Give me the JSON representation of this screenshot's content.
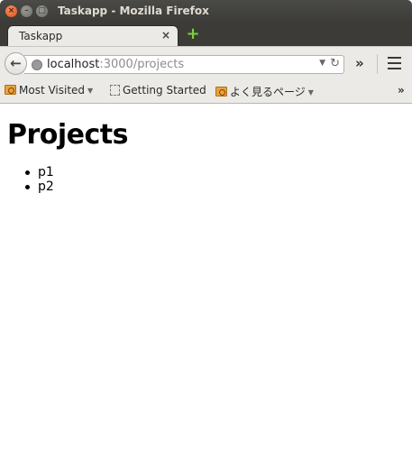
{
  "window": {
    "title": "Taskapp - Mozilla Firefox",
    "close_glyph": "×",
    "minimize_glyph": "–",
    "maximize_glyph": "□"
  },
  "tabs": [
    {
      "label": "Taskapp",
      "close_glyph": "×",
      "active": true
    }
  ],
  "new_tab_glyph": "+",
  "nav": {
    "back_glyph": "←",
    "url_host": "localhost",
    "url_path": ":3000/projects",
    "url_dropdown_glyph": "▼",
    "reload_glyph": "↻",
    "overflow_glyph": "»",
    "menu_icon": "hamburger-icon"
  },
  "bookmarks": {
    "items": [
      {
        "label": "Most Visited",
        "icon": "folder-icon",
        "has_dropdown": true
      },
      {
        "label": "Getting Started",
        "icon": "page-icon",
        "has_dropdown": false
      },
      {
        "label": "よく見るページ",
        "icon": "folder-icon",
        "has_dropdown": true
      }
    ],
    "dropdown_glyph": "▼",
    "overflow_glyph": "»"
  },
  "page": {
    "heading": "Projects",
    "projects": [
      "p1",
      "p2"
    ]
  },
  "colors": {
    "titlebar": "#3c3b37",
    "toolbar": "#ebeae7",
    "close_button": "#e0501b",
    "new_tab": "#7fd03a"
  }
}
